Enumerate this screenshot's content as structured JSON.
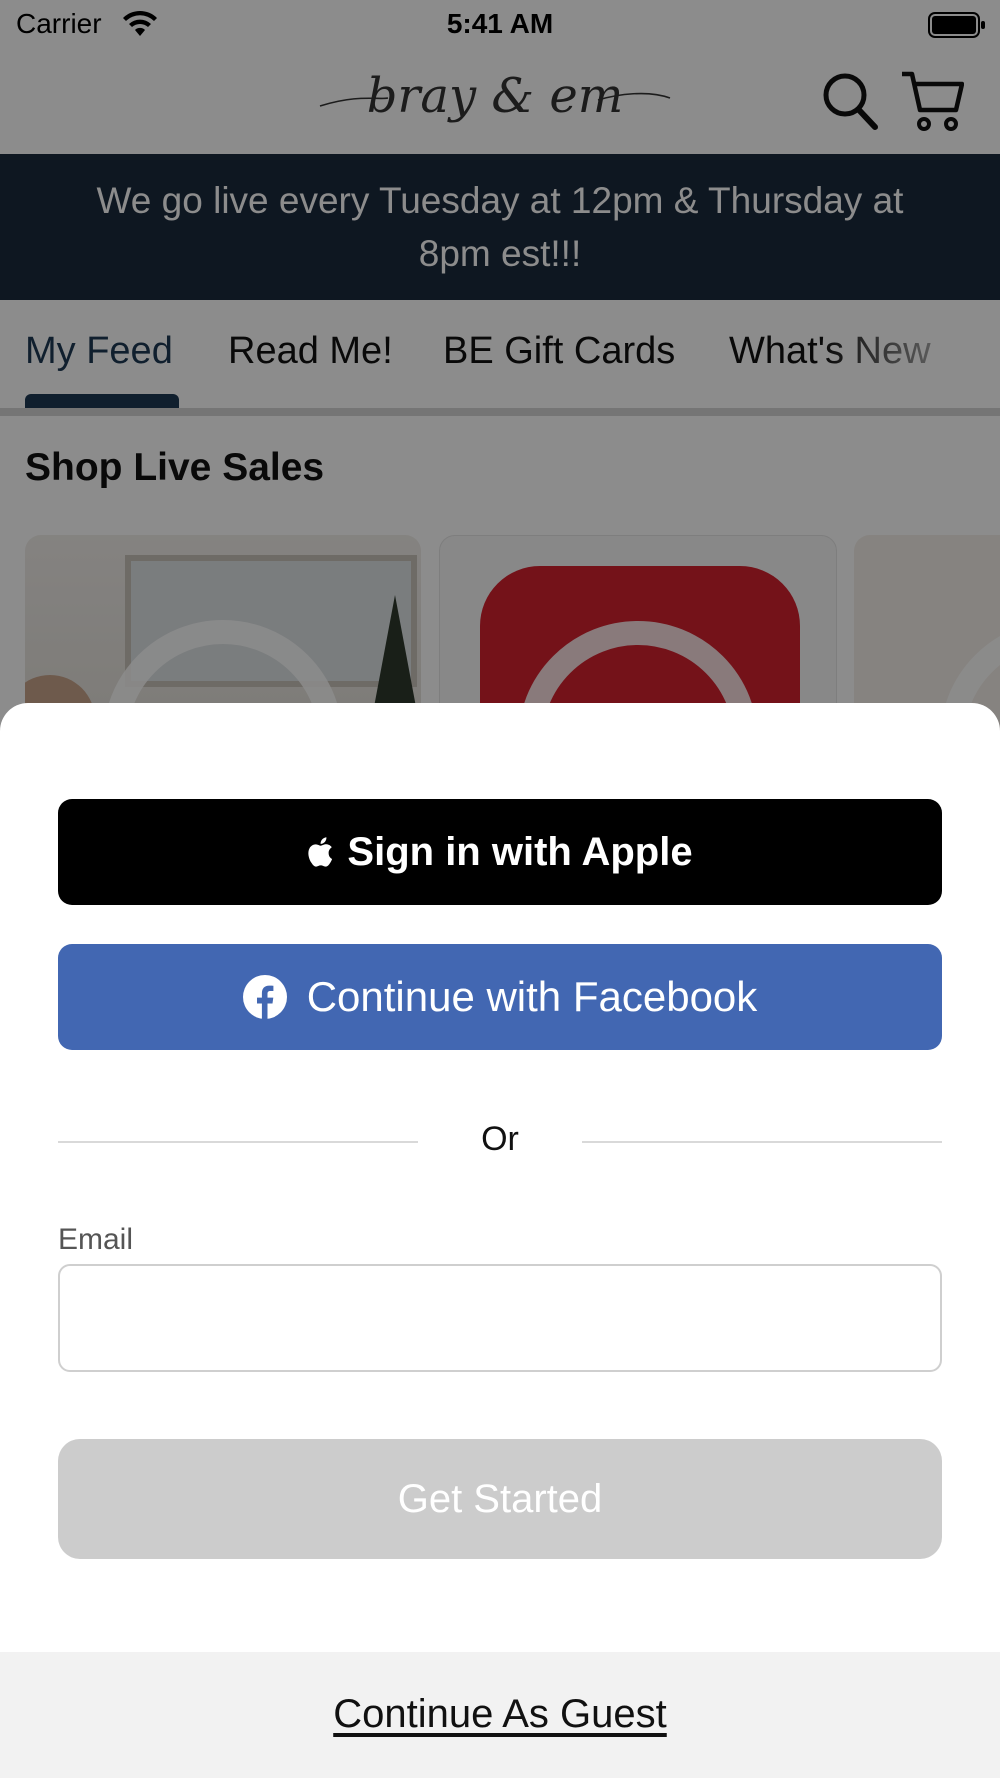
{
  "status_bar": {
    "carrier": "Carrier",
    "time": "5:41 AM"
  },
  "header": {
    "logo_text": "bray & em",
    "icons": [
      "search-icon",
      "cart-icon"
    ]
  },
  "banner": {
    "text": "We go live every Tuesday at 12pm & Thursday at 8pm est!!!"
  },
  "tabs": [
    {
      "label": "My Feed",
      "active": true
    },
    {
      "label": "Read Me!",
      "active": false
    },
    {
      "label": "BE Gift Cards",
      "active": false
    },
    {
      "label": "What's New",
      "active": false
    }
  ],
  "feed": {
    "section_title": "Shop Live Sales"
  },
  "auth_sheet": {
    "apple_label": "Sign in with Apple",
    "facebook_label": "Continue with Facebook",
    "divider_text": "Or",
    "email_label": "Email",
    "email_value": "",
    "email_placeholder": "",
    "get_started_label": "Get Started",
    "guest_label": "Continue As Guest"
  },
  "colors": {
    "banner_bg": "#1a2a3d",
    "accent": "#1e3a54",
    "facebook_blue": "#4267b2",
    "apple_black": "#000000",
    "disabled_button": "#cccccc"
  }
}
